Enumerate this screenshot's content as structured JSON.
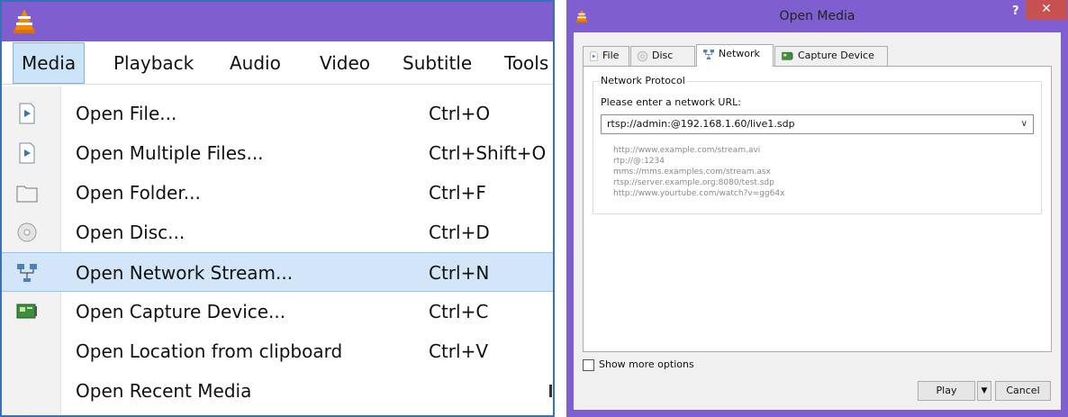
{
  "vlc_menu": {
    "menubar": [
      "Media",
      "Playback",
      "Audio",
      "Video",
      "Subtitle",
      "Tools"
    ],
    "active_menu": "Media",
    "items": [
      {
        "label": "Open File...",
        "shortcut": "Ctrl+O",
        "icon": "file-icon"
      },
      {
        "label": "Open Multiple Files...",
        "shortcut": "Ctrl+Shift+O",
        "icon": "files-icon"
      },
      {
        "label": "Open Folder...",
        "shortcut": "Ctrl+F",
        "icon": "folder-icon"
      },
      {
        "label": "Open Disc...",
        "shortcut": "Ctrl+D",
        "icon": "disc-icon"
      },
      {
        "label": "Open Network Stream...",
        "shortcut": "Ctrl+N",
        "icon": "network-icon",
        "highlighted": true
      },
      {
        "label": "Open Capture Device...",
        "shortcut": "Ctrl+C",
        "icon": "capture-card-icon"
      },
      {
        "label": "Open Location from clipboard",
        "shortcut": "Ctrl+V",
        "icon": ""
      },
      {
        "label": "Open Recent Media",
        "shortcut": "",
        "icon": "",
        "submenu": true
      }
    ]
  },
  "dialog": {
    "title": "Open Media",
    "help": "?",
    "close": "✕",
    "tabs": [
      {
        "label": "File",
        "icon": "file-icon"
      },
      {
        "label": "Disc",
        "icon": "disc-icon"
      },
      {
        "label": "Network",
        "icon": "network-icon",
        "selected": true
      },
      {
        "label": "Capture Device",
        "icon": "capture-card-icon"
      }
    ],
    "group_title": "Network Protocol",
    "prompt": "Please enter a network URL:",
    "url_value": "rtsp://admin:@192.168.1.60/live1.sdp",
    "examples": [
      "http://www.example.com/stream.avi",
      "rtp://@:1234",
      "mms://mms.examples.com/stream.asx",
      "rtsp://server.example.org:8080/test.sdp",
      "http://www.yourtube.com/watch?v=gg64x"
    ],
    "show_more_options": "Show more options",
    "play_button": "Play",
    "cancel_button": "Cancel"
  },
  "colors": {
    "titlebar": "#7f5fd0",
    "menu_highlight": "#d3e5f8",
    "close_button": "#c75050"
  }
}
